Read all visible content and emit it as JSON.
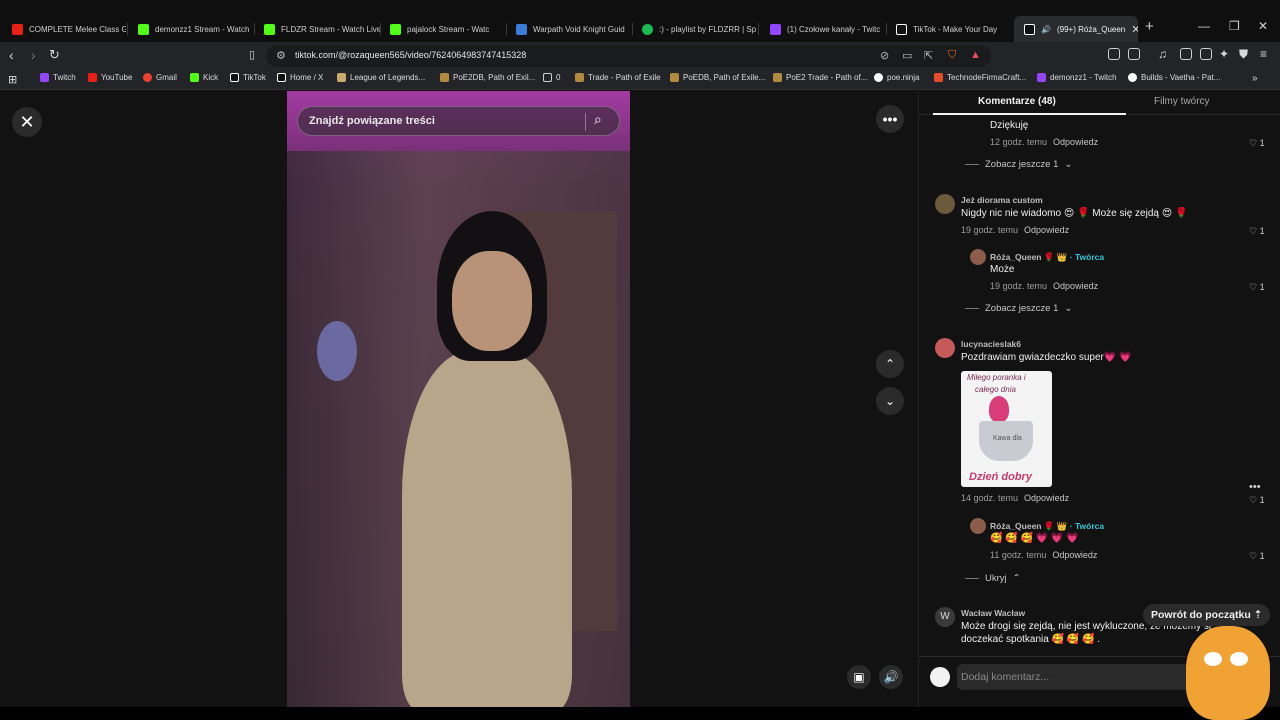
{
  "browser": {
    "tabs": [
      {
        "title": "COMPLETE Melee Class G",
        "fav_color": "#e62117"
      },
      {
        "title": "demonzz1 Stream - Watch",
        "fav_color": "#53fc18"
      },
      {
        "title": "FLDZR Stream - Watch Live",
        "fav_color": "#53fc18"
      },
      {
        "title": "pajalock Stream - Watc",
        "fav_color": "#53fc18"
      },
      {
        "title": "Warpath Void Knight Guid",
        "fav_color": "#3d7bd6"
      },
      {
        "title": ":) - playlist by FLDZRR | Sp",
        "fav_color": "#1db954"
      },
      {
        "title": "(1) Czołowe kanały - Twitc",
        "fav_color": "#9146ff"
      },
      {
        "title": "TikTok - Make Your Day",
        "fav_color": "#ffffff"
      },
      {
        "title": "(99+) Róża_Queen",
        "fav_color": "#ffffff"
      }
    ],
    "url": "tiktok.com/@rozaqueen565/video/7624064983747415328",
    "bookmarks": [
      {
        "label": "Twitch",
        "color": "#9146ff"
      },
      {
        "label": "YouTube",
        "color": "#e62117"
      },
      {
        "label": "Gmail",
        "color": "#ea4335"
      },
      {
        "label": "Kick",
        "color": "#53fc18"
      },
      {
        "label": "TikTok",
        "color": "#ffffff"
      },
      {
        "label": "Home / X",
        "color": "#ffffff"
      },
      {
        "label": "League of Legends...",
        "color": "#c8aa6e"
      },
      {
        "label": "PoE2DB, Path of Exil...",
        "color": "#b08a3e"
      },
      {
        "label": "0",
        "color": "#cfcfcf"
      },
      {
        "label": "Trade - Path of Exile",
        "color": "#b08a3e"
      },
      {
        "label": "PoEDB, Path of Exile...",
        "color": "#b08a3e"
      },
      {
        "label": "PoE2 Trade - Path of...",
        "color": "#b08a3e"
      },
      {
        "label": "poe.ninja",
        "color": "#ffffff"
      },
      {
        "label": "TechnodeFirmaCraft...",
        "color": "#e54b2a"
      },
      {
        "label": "demonzz1 - Twitch",
        "color": "#9146ff"
      },
      {
        "label": "Builds - Vaetha - Pat...",
        "color": "#ffffff"
      }
    ]
  },
  "video": {
    "search_placeholder": "Znajdź powiązane treści"
  },
  "panel": {
    "tab_comments": "Komentarze (48)",
    "tab_creator_videos": "Filmy twórcy",
    "reply_label": "Odpowiedz",
    "creator_label": "· Twórca",
    "comments": [
      {
        "text": "Dziękuję",
        "time": "12 godz. temu",
        "likes": "1"
      },
      {
        "more": "Zobacz jeszcze 1"
      },
      {
        "name": "Jeż diorama custom",
        "text": "Nigdy nic nie wiadomo 😍 🌹 Może się zejdą 😍 🌹",
        "time": "19 godz. temu",
        "likes": "1"
      },
      {
        "name": "Róża_Queen 🌹 👑",
        "text": "Może",
        "time": "19 godz. temu",
        "likes": "1"
      },
      {
        "more": "Zobacz jeszcze 1"
      },
      {
        "name": "lucynacieslak6",
        "text": "Pozdrawiam gwiazdeczko super💗 💗",
        "time": "14 godz. temu",
        "likes": "1",
        "image": {
          "line1": "Miłego poranka i",
          "line2": "całego dnia",
          "cup_text": "Kawa dla",
          "bottom": "Dzień dobry"
        }
      },
      {
        "name": "Róża_Queen 🌹 👑",
        "text": "🥰 🥰 🥰 💗 💗 💗",
        "time": "11 godz. temu",
        "likes": "1"
      },
      {
        "more": "Ukryj"
      },
      {
        "name": "Wacław Wacław",
        "avatar_letter": "W",
        "text": "Może drogi się zejdą, nie jest wykluczone, że możemy si",
        "text2": "doczekać spotkania 🥰 🥰 🥰 ."
      }
    ],
    "back_to_top": "Powrót do początku",
    "add_comment_placeholder": "Dodaj komentarz..."
  }
}
